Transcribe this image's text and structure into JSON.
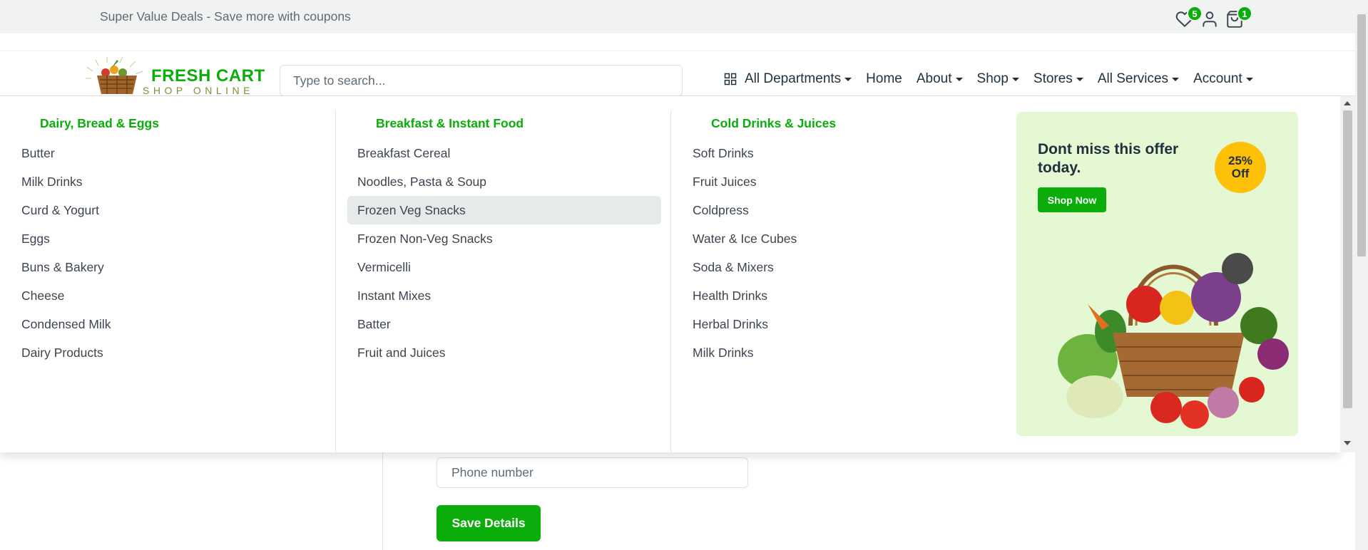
{
  "topbar": {
    "promo_text": "Super Value Deals - Save more with coupons",
    "wishlist_count": "5",
    "cart_count": "1"
  },
  "brand": {
    "name": "FRESH CART",
    "tagline": "SHOP ONLINE"
  },
  "search": {
    "placeholder": "Type to search..."
  },
  "nav": {
    "all_departments": "All Departments",
    "home": "Home",
    "about": "About",
    "shop": "Shop",
    "stores": "Stores",
    "all_services": "All Services",
    "account": "Account"
  },
  "mega_menu": {
    "col1": {
      "heading": "Dairy, Bread & Eggs",
      "items": [
        "Butter",
        "Milk Drinks",
        "Curd & Yogurt",
        "Eggs",
        "Buns & Bakery",
        "Cheese",
        "Condensed Milk",
        "Dairy Products"
      ]
    },
    "col2": {
      "heading": "Breakfast & Instant Food",
      "items": [
        "Breakfast Cereal",
        "Noodles, Pasta & Soup",
        "Frozen Veg Snacks",
        "Frozen Non-Veg Snacks",
        "Vermicelli",
        "Instant Mixes",
        "Batter",
        "Fruit and Juices"
      ]
    },
    "col3": {
      "heading": "Cold Drinks & Juices",
      "items": [
        "Soft Drinks",
        "Fruit Juices",
        "Coldpress",
        "Water & Ice Cubes",
        "Soda & Mixers",
        "Health Drinks",
        "Herbal Drinks",
        "Milk Drinks"
      ]
    },
    "promo": {
      "title": "Dont miss this offer today.",
      "button": "Shop Now",
      "discount_line1": "25%",
      "discount_line2": "Off"
    }
  },
  "form": {
    "phone_placeholder": "Phone number",
    "save_label": "Save Details"
  },
  "colors": {
    "accent": "#0aad0a",
    "topbar_bg": "#f0f3f2",
    "promo_bg": "#e3f8d3",
    "discount_badge": "#ffc107"
  }
}
